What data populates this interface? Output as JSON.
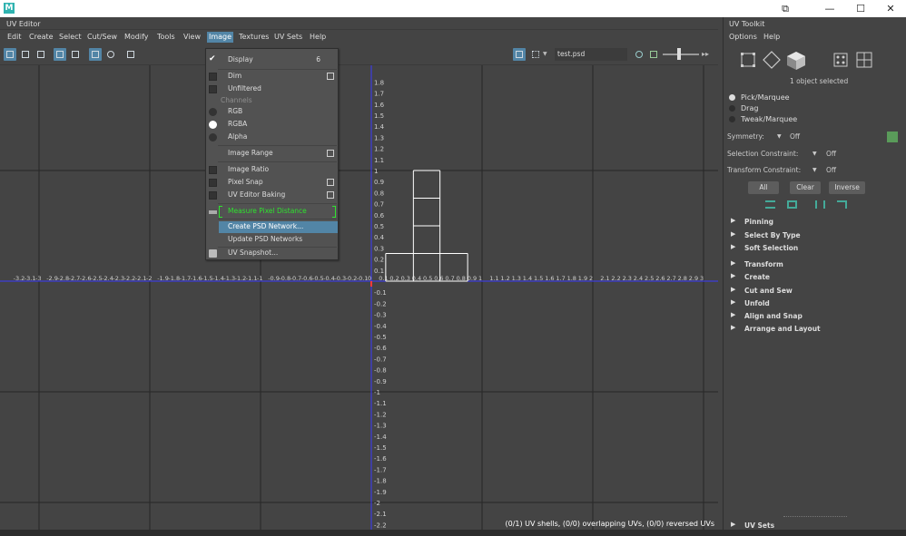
{
  "window": {
    "title": "UV Editor",
    "controls": [
      "⧉",
      "—",
      "☐",
      "✕"
    ]
  },
  "menubar": {
    "items": [
      "Edit",
      "Create",
      "Select",
      "Cut/Sew",
      "Modify",
      "Tools",
      "View",
      "Image",
      "Textures",
      "UV Sets",
      "Help"
    ],
    "active": "Image"
  },
  "toolbar": {
    "image_name": "test.psd"
  },
  "image_menu": {
    "display_label": "Display",
    "display_value": "6",
    "dim_label": "Dim",
    "unfiltered_label": "Unfiltered",
    "channels_header": "Channels",
    "rgb_label": "RGB",
    "rgba_label": "RGBA",
    "alpha_label": "Alpha",
    "image_range_label": "Image Range",
    "image_ratio_label": "Image Ratio",
    "pixel_snap_label": "Pixel Snap",
    "uv_editor_baking_label": "UV Editor Baking",
    "measure_pixel_distance_label": "Measure Pixel Distance",
    "create_psd_network_label": "Create PSD Network...",
    "update_psd_networks_label": "Update PSD Networks",
    "uv_snapshot_label": "UV Snapshot..."
  },
  "viewport": {
    "status": "(0/1) UV shells, (0/0) overlapping UVs, (0/0) reversed UVs",
    "v_tick_labels_upper": [
      "1.8",
      "1.7",
      "1.6",
      "1.5",
      "1.4",
      "1.3",
      "1.2",
      "1.1",
      "1",
      "0.9",
      "0.8",
      "0.7",
      "0.6",
      "0.5",
      "0.4",
      "0.3",
      "0.2",
      "0.1"
    ],
    "v_tick_labels_lower": [
      "-0.1",
      "-0.2",
      "-0.3",
      "-0.4",
      "-0.5",
      "-0.6",
      "-0.7",
      "-0.8",
      "-0.9",
      "-1",
      "-1.1",
      "-1.2",
      "-1.3",
      "-1.4",
      "-1.5",
      "-1.6",
      "-1.7",
      "-1.8",
      "-1.9",
      "-2",
      "-2.1",
      "-2.2"
    ],
    "u_tick_labels": [
      "-4.3",
      "-3.2",
      "-3.1",
      "-3",
      "-2.9",
      "-2.8",
      "-2.7",
      "-2.6",
      "-2.5",
      "-2.4",
      "-2.3",
      "-2.2",
      "-2.1",
      "-2",
      "-1.9",
      "-1.8",
      "-1.7",
      "-1.6",
      "-1.5",
      "-1.4",
      "-1.3",
      "-1.2",
      "-1.1",
      "-1",
      "-0.9",
      "-0.8",
      "-0.7",
      "-0.6",
      "-0.5",
      "-0.4",
      "-0.3",
      "-0.2",
      "-0.1",
      "0",
      "0.1",
      "0.2",
      "0.3",
      "0.4",
      "0.5",
      "0.6",
      "0.7",
      "0.8",
      "0.9",
      "1",
      "1.1",
      "1.2",
      "1.3",
      "1.4",
      "1.5",
      "1.6",
      "1.7",
      "1.8",
      "1.9",
      "2",
      "2.1",
      "2.2",
      "2.3",
      "2.4",
      "2.5",
      "2.6",
      "2.7",
      "2.8",
      "2.9",
      "3"
    ],
    "uv_shell_edges": [
      [
        0.13,
        0.0,
        0.13,
        0.25
      ],
      [
        0.13,
        0.25,
        0.87,
        0.25
      ],
      [
        0.87,
        0.25,
        0.87,
        0.0
      ],
      [
        0.87,
        0.0,
        0.13,
        0.0
      ],
      [
        0.38,
        0.0,
        0.38,
        1.0
      ],
      [
        0.62,
        0.0,
        0.62,
        1.0
      ],
      [
        0.38,
        0.25,
        0.62,
        0.25
      ],
      [
        0.38,
        0.5,
        0.62,
        0.5
      ],
      [
        0.38,
        0.75,
        0.62,
        0.75
      ],
      [
        0.38,
        1.0,
        0.62,
        1.0
      ]
    ]
  },
  "toolkit": {
    "title": "UV Toolkit",
    "menu": [
      "Options",
      "Help"
    ],
    "selection_info": "1 object selected",
    "modes": [
      "Pick/Marquee",
      "Drag",
      "Tweak/Marquee"
    ],
    "selected_mode": "Pick/Marquee",
    "symmetry_label": "Symmetry:",
    "symmetry_value": "Off",
    "selection_constraint_label": "Selection Constraint:",
    "selection_constraint_value": "Off",
    "transform_constraint_label": "Transform Constraint:",
    "transform_constraint_value": "Off",
    "btn_all": "All",
    "btn_clear": "Clear",
    "btn_inverse": "Inverse",
    "sections_a": [
      "Pinning",
      "Select By Type",
      "Soft Selection"
    ],
    "sections_b": [
      "Transform",
      "Create",
      "Cut and Sew",
      "Unfold",
      "Align and Snap",
      "Arrange and Layout"
    ],
    "uv_sets_label": "UV Sets"
  }
}
